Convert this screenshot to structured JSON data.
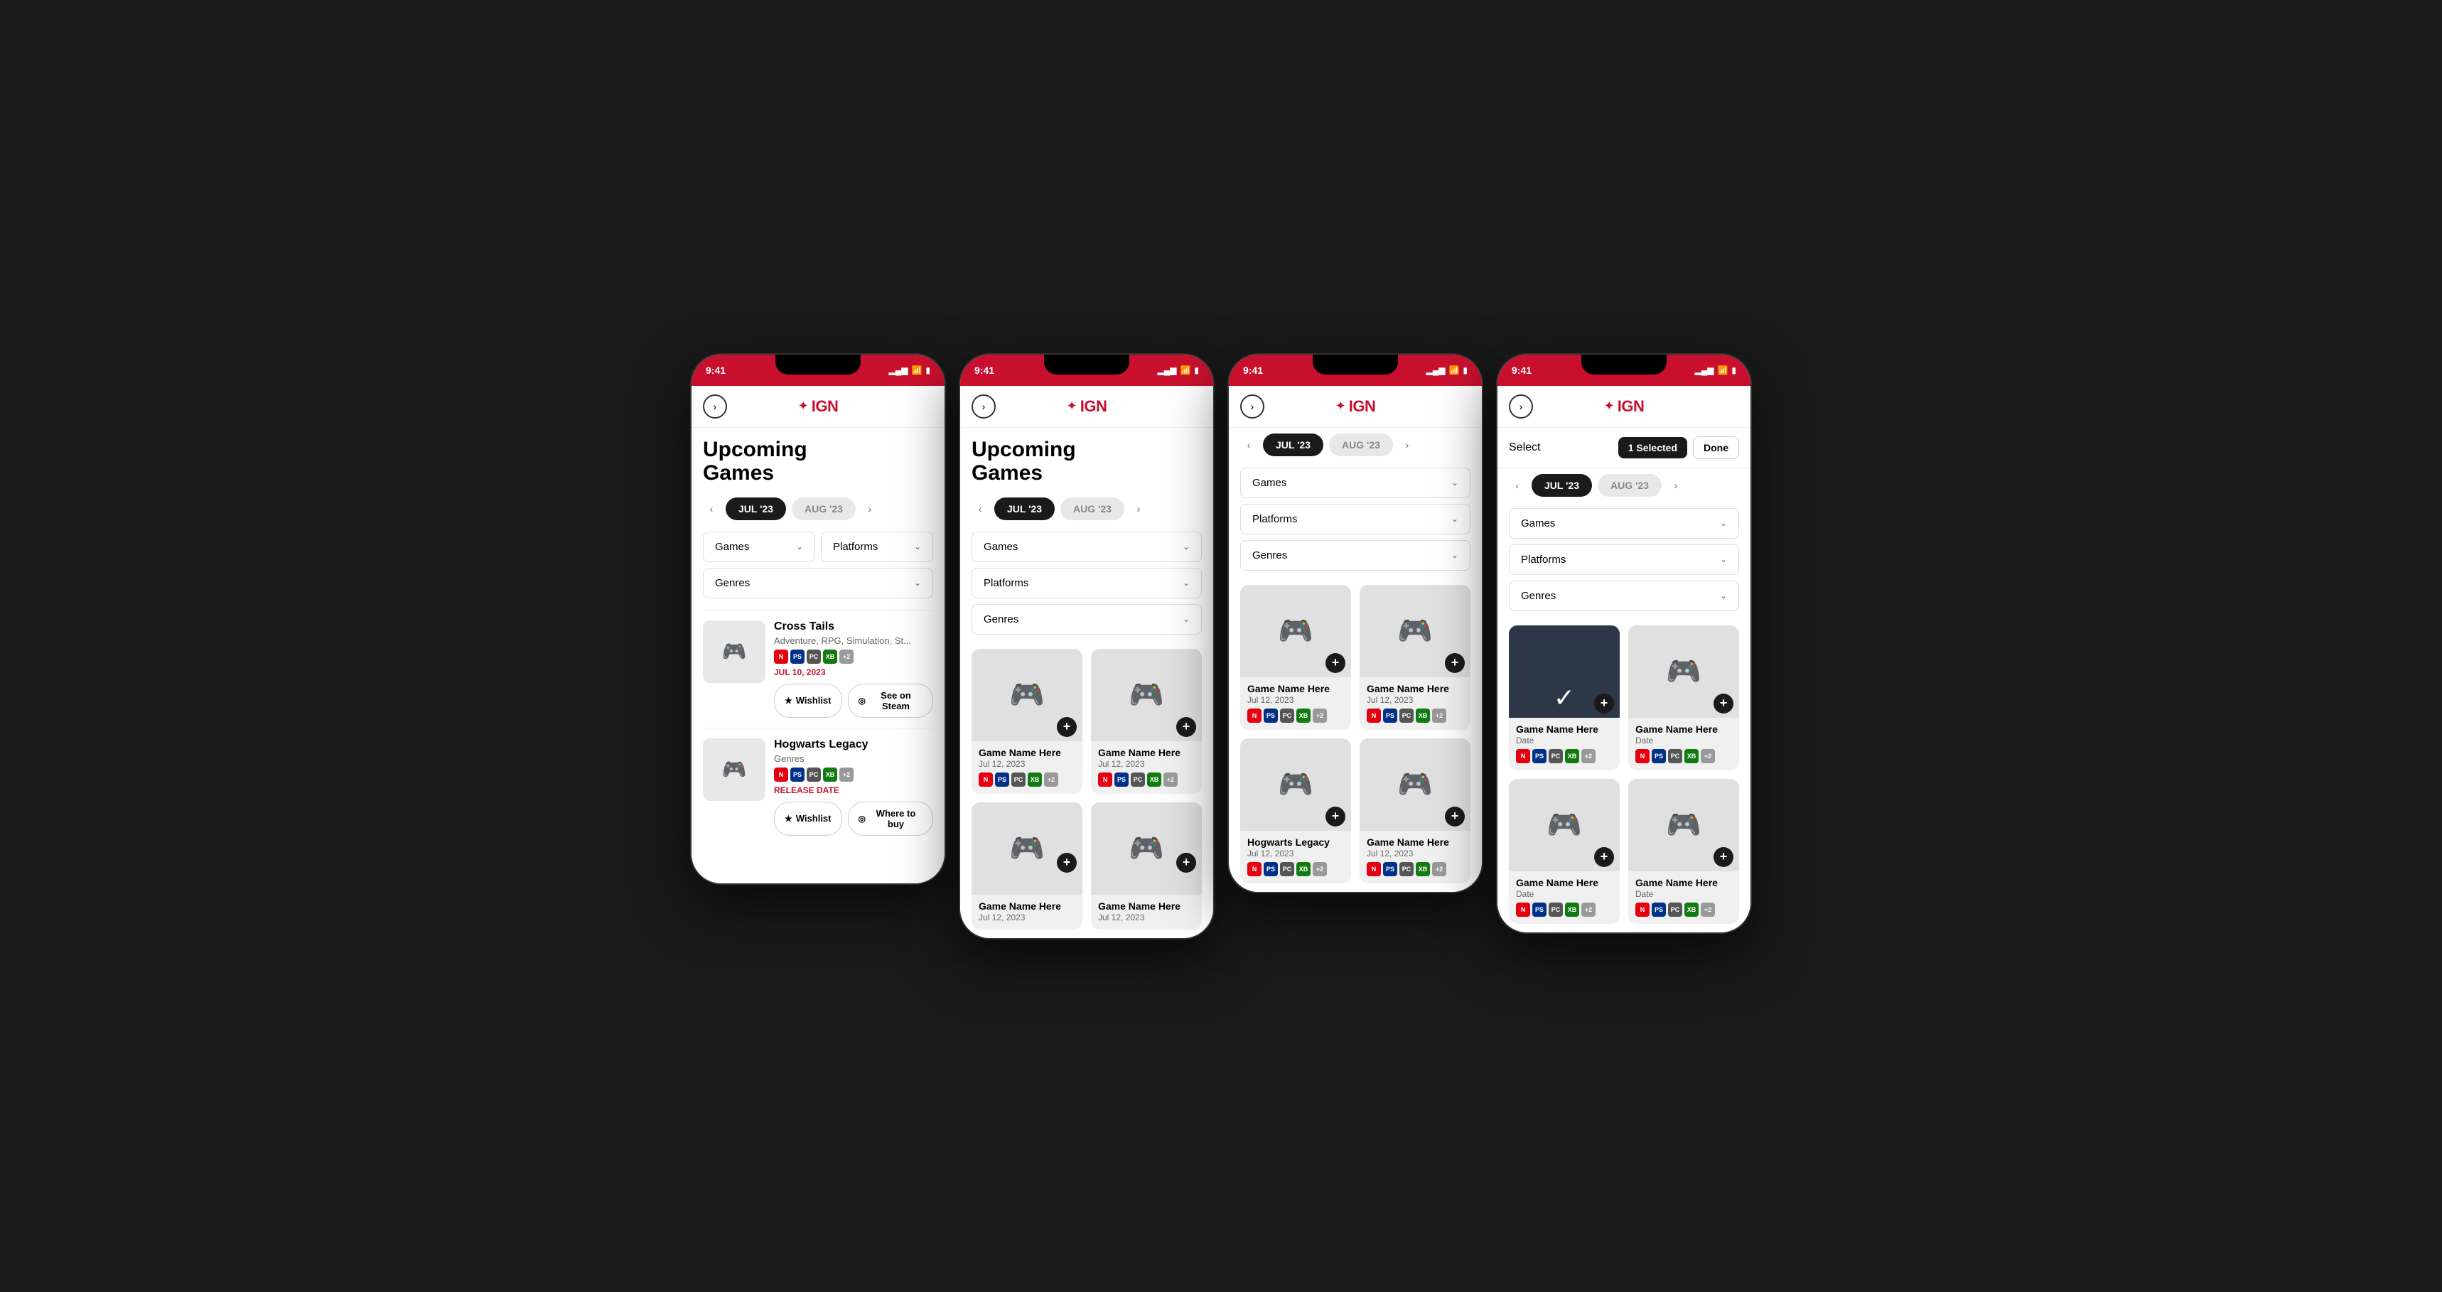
{
  "phones": [
    {
      "id": "phone1",
      "statusBar": {
        "time": "9:41",
        "signal": "▂▄▆",
        "wifi": "WiFi",
        "battery": "Battery"
      },
      "header": {
        "backIcon": "‹",
        "logoStar": "✦",
        "logoText": "IGN"
      },
      "pageTitle": "Upcoming\nGames",
      "monthTabs": {
        "prev": "‹",
        "next": "›",
        "tabs": [
          {
            "label": "JUL '23",
            "active": true
          },
          {
            "label": "AUG '23",
            "active": false
          }
        ]
      },
      "filters": {
        "row1": [
          {
            "label": "Games",
            "hasChevron": true
          },
          {
            "label": "Platforms",
            "hasChevron": true
          }
        ],
        "row2": [
          {
            "label": "Genres",
            "hasChevron": true
          }
        ]
      },
      "games": [
        {
          "title": "Cross Tails",
          "genre": "Adventure, RPG, Simulation, St...",
          "platforms": [
            "N",
            "PS",
            "PC",
            "XB",
            "+2"
          ],
          "date": "JUL 10, 2023",
          "dateRed": true,
          "actions": [
            {
              "icon": "★",
              "label": "Wishlist"
            },
            {
              "icon": "◎",
              "label": "See on Steam"
            }
          ]
        },
        {
          "title": "Hogwarts Legacy",
          "genre": "Genres",
          "platforms": [
            "N",
            "PS",
            "PC",
            "XB",
            "+2"
          ],
          "date": "RELEASE DATE",
          "dateRed": true,
          "actions": [
            {
              "icon": "★",
              "label": "Wishlist"
            },
            {
              "icon": "◎",
              "label": "Where to buy"
            }
          ]
        }
      ]
    },
    {
      "id": "phone2",
      "statusBar": {
        "time": "9:41"
      },
      "header": {
        "backIcon": "‹",
        "logoStar": "✦",
        "logoText": "IGN"
      },
      "pageTitle": "Upcoming\nGames",
      "monthTabs": {
        "prev": "‹",
        "next": "›",
        "tabs": [
          {
            "label": "JUL '23",
            "active": true
          },
          {
            "label": "AUG '23",
            "active": false
          }
        ]
      },
      "filters": {
        "fullWidth": [
          {
            "label": "Games",
            "hasChevron": true
          },
          {
            "label": "Platforms",
            "hasChevron": true
          },
          {
            "label": "Genres",
            "hasChevron": true
          }
        ]
      },
      "gameCards": [
        {
          "title": "Game Name Here",
          "date": "Jul 12, 2023",
          "platforms": [
            "N",
            "PS",
            "PC",
            "XB",
            "+2"
          ]
        },
        {
          "title": "Game Name Here",
          "date": "Jul 12, 2023",
          "platforms": [
            "N",
            "PS",
            "PC",
            "XB",
            "+2"
          ]
        },
        {
          "title": "Game Name Here",
          "date": "Jul 12, 2023",
          "platforms": []
        },
        {
          "title": "Game Name Here",
          "date": "Jul 12, 2023",
          "platforms": []
        }
      ]
    },
    {
      "id": "phone3",
      "statusBar": {
        "time": "9:41"
      },
      "header": {
        "backIcon": "‹",
        "logoStar": "✦",
        "logoText": "IGN"
      },
      "monthTabs": {
        "prev": "‹",
        "next": "›",
        "tabs": [
          {
            "label": "JUL '23",
            "active": true
          },
          {
            "label": "AUG '23",
            "active": false
          }
        ]
      },
      "filters": {
        "fullWidth": [
          {
            "label": "Games",
            "hasChevron": true
          },
          {
            "label": "Platforms",
            "hasChevron": true
          },
          {
            "label": "Genres",
            "hasChevron": true
          }
        ]
      },
      "gameCards": [
        {
          "title": "Game Name Here",
          "date": "Jul 12, 2023",
          "platforms": [
            "N",
            "PS",
            "PC",
            "XB",
            "+2"
          ],
          "selected": false
        },
        {
          "title": "Game Name Here",
          "date": "Jul 12, 2023",
          "platforms": [
            "N",
            "PS",
            "PC",
            "XB",
            "+2"
          ],
          "selected": false
        },
        {
          "title": "Hogwarts Legacy",
          "date": "Jul 12, 2023",
          "platforms": [
            "N",
            "PS",
            "PC",
            "XB",
            "+2"
          ],
          "selected": false
        },
        {
          "title": "Game Name Here",
          "date": "Jul 12, 2023",
          "platforms": [
            "N",
            "PS",
            "PC",
            "XB",
            "+2"
          ],
          "selected": false
        }
      ]
    },
    {
      "id": "phone4",
      "statusBar": {
        "time": "9:41"
      },
      "header": {
        "backIcon": "‹",
        "logoStar": "✦",
        "logoText": "IGN"
      },
      "selectBar": {
        "label": "Select",
        "selectedCount": "1 Selected",
        "doneLabel": "Done"
      },
      "monthTabs": {
        "prev": "‹",
        "next": "›",
        "tabs": [
          {
            "label": "JUL '23",
            "active": true
          },
          {
            "label": "AUG '23",
            "active": false
          }
        ]
      },
      "filters": {
        "fullWidth": [
          {
            "label": "Games",
            "hasChevron": true
          },
          {
            "label": "Platforms",
            "hasChevron": true
          },
          {
            "label": "Genres",
            "hasChevron": true
          }
        ]
      },
      "gameCards": [
        {
          "title": "Game Name Here",
          "date": "Date",
          "platforms": [
            "N",
            "PS",
            "PC",
            "XB",
            "+2"
          ],
          "selected": true
        },
        {
          "title": "Game Name Here",
          "date": "Date",
          "platforms": [
            "N",
            "PS",
            "PC",
            "XB",
            "+2"
          ],
          "selected": false
        },
        {
          "title": "Game Name Here",
          "date": "Date",
          "platforms": [
            "N",
            "PS",
            "PC",
            "XB",
            "+2"
          ],
          "selected": false
        },
        {
          "title": "Game Name Here",
          "date": "Date",
          "platforms": [
            "N",
            "PS",
            "PC",
            "XB",
            "+2"
          ],
          "selected": false
        }
      ]
    }
  ],
  "platformColors": {
    "N": "#e4000f",
    "PS": "#003087",
    "PC": "#555555",
    "XB": "#107c10",
    "+2": "#999999"
  }
}
